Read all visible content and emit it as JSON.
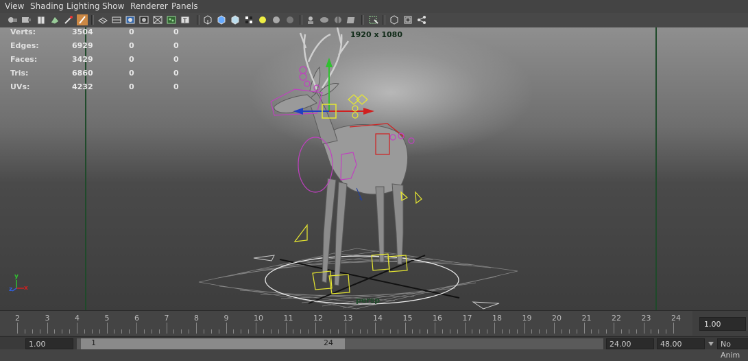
{
  "menubar": {
    "items": [
      "View",
      "Shading",
      "Lighting",
      "Show",
      "Renderer",
      "Panels"
    ]
  },
  "toolbar": {
    "icons": [
      "select-camera-icon",
      "camera-attributes-icon",
      "bookmark-icon",
      "image-plane-icon",
      "2d-pan-zoom-icon",
      "grease-pencil-icon",
      "grid-icon",
      "film-gate-icon",
      "resolution-gate-icon",
      "gate-mask-icon",
      "field-chart-icon",
      "safe-action-icon",
      "safe-title-icon",
      "wireframe-icon",
      "smooth-shade-icon",
      "default-material-icon",
      "textured-icon",
      "use-all-lights-icon",
      "shadows-icon",
      "screen-space-ao-icon",
      "motion-blur-icon",
      "multisample-aa-icon",
      "depth-of-field-icon",
      "xray-icon",
      "isolate-select-icon",
      "xray-joints-icon",
      "xray-active-icon",
      "two-panel-icon"
    ]
  },
  "hud": {
    "resolution": "1920 x 1080",
    "camera": "persp",
    "stats": [
      {
        "label": "Verts:",
        "total": "3504",
        "sel": "0",
        "comp": "0"
      },
      {
        "label": "Edges:",
        "total": "6929",
        "sel": "0",
        "comp": "0"
      },
      {
        "label": "Faces:",
        "total": "3429",
        "sel": "0",
        "comp": "0"
      },
      {
        "label": "Tris:",
        "total": "6860",
        "sel": "0",
        "comp": "0"
      },
      {
        "label": "UVs:",
        "total": "4232",
        "sel": "0",
        "comp": "0"
      }
    ],
    "axis": {
      "y": "y",
      "z": "z",
      "x": "x"
    }
  },
  "timeline": {
    "ticks": [
      "2",
      "3",
      "4",
      "5",
      "6",
      "7",
      "8",
      "9",
      "10",
      "11",
      "12",
      "13",
      "14",
      "15",
      "16",
      "17",
      "18",
      "19",
      "20",
      "21",
      "22",
      "23",
      "24"
    ],
    "current_frame": "1.00"
  },
  "range": {
    "start": "1.00",
    "slider_start": "1",
    "slider_end": "24",
    "end": "24.00",
    "anim_end": "48.00",
    "anim_layer": "No Anim"
  },
  "colors": {
    "gate_line": "#1f4a2a",
    "rig_magenta": "#c040c0",
    "rig_yellow": "#e8e830",
    "rig_red": "#d02020"
  }
}
